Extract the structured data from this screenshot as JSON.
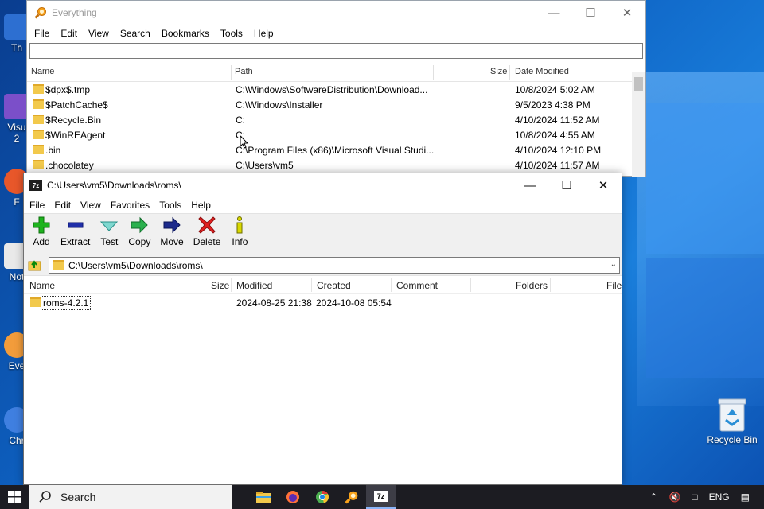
{
  "desktop": {
    "icons": [
      {
        "label": "Th",
        "color": "#2d6fd1"
      },
      {
        "label": "Visu\n2",
        "color": "#7b4fc9"
      },
      {
        "label": "F",
        "color": "#e8572a"
      },
      {
        "label": "Not",
        "color": "#e9e9e9"
      },
      {
        "label": "Eve",
        "color": "#f29c3b"
      },
      {
        "label": "Chr",
        "color": "#3f7fe0"
      }
    ],
    "recycle_bin": "Recycle Bin"
  },
  "everything": {
    "title": "Everything",
    "menu": [
      "File",
      "Edit",
      "View",
      "Search",
      "Bookmarks",
      "Tools",
      "Help"
    ],
    "search_value": "",
    "columns": {
      "name": "Name",
      "path": "Path",
      "size": "Size",
      "date": "Date Modified"
    },
    "rows": [
      {
        "name": "$dpx$.tmp",
        "path": "C:\\Windows\\SoftwareDistribution\\Download...",
        "size": "",
        "date": "10/8/2024 5:02 AM"
      },
      {
        "name": "$PatchCache$",
        "path": "C:\\Windows\\Installer",
        "size": "",
        "date": "9/5/2023 4:38 PM"
      },
      {
        "name": "$Recycle.Bin",
        "path": "C:",
        "size": "",
        "date": "4/10/2024 11:52 AM"
      },
      {
        "name": "$WinREAgent",
        "path": "C:",
        "size": "",
        "date": "10/8/2024 4:55 AM"
      },
      {
        "name": ".bin",
        "path": "C:\\Program Files (x86)\\Microsoft Visual Studi...",
        "size": "",
        "date": "4/10/2024 12:10 PM"
      },
      {
        "name": ".chocolatey",
        "path": "C:\\Users\\vm5",
        "size": "",
        "date": "4/10/2024 11:57 AM"
      }
    ]
  },
  "sevenzip": {
    "title": "C:\\Users\\vm5\\Downloads\\roms\\",
    "menu": [
      "File",
      "Edit",
      "View",
      "Favorites",
      "Tools",
      "Help"
    ],
    "toolbar": [
      "Add",
      "Extract",
      "Test",
      "Copy",
      "Move",
      "Delete",
      "Info"
    ],
    "address": "C:\\Users\\vm5\\Downloads\\roms\\",
    "columns": {
      "name": "Name",
      "size": "Size",
      "modified": "Modified",
      "created": "Created",
      "comment": "Comment",
      "folders": "Folders",
      "files": "File"
    },
    "rows": [
      {
        "name": "roms-4.2.1",
        "size": "",
        "modified": "2024-08-25 21:38",
        "created": "2024-10-08 05:54",
        "comment": "",
        "folders": "",
        "files": ""
      }
    ]
  },
  "taskbar": {
    "search_label": "Search",
    "apps": [
      "file-explorer",
      "firefox",
      "chrome",
      "everything",
      "7zip"
    ],
    "language": "ENG"
  }
}
